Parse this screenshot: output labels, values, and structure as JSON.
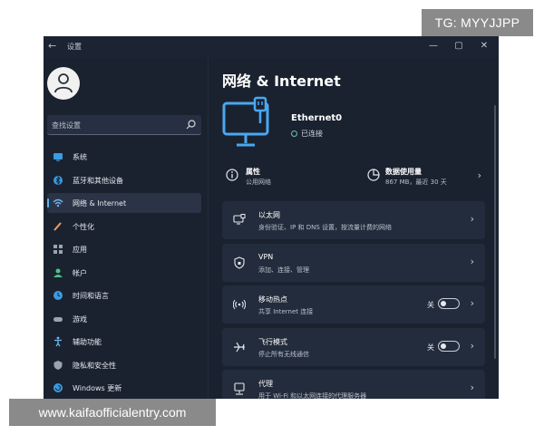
{
  "watermarks": {
    "top_right": "TG: MYYJJPP",
    "bottom_left": "www.kaifaofficialentry.com"
  },
  "window": {
    "title": "设置",
    "controls": {
      "minimize": "—",
      "maximize": "▢",
      "close": "✕"
    }
  },
  "sidebar": {
    "search_placeholder": "查找设置",
    "items": [
      {
        "label": "系统",
        "icon": "monitor-icon",
        "color": "#3b9be0"
      },
      {
        "label": "蓝牙和其他设备",
        "icon": "bluetooth-icon",
        "color": "#3b9be0"
      },
      {
        "label": "网络 & Internet",
        "icon": "wifi-icon",
        "color": "#6ab7f0",
        "active": true
      },
      {
        "label": "个性化",
        "icon": "brush-icon",
        "color": "#e8a06a"
      },
      {
        "label": "应用",
        "icon": "apps-icon",
        "color": "#9aa3b0"
      },
      {
        "label": "帐户",
        "icon": "person-icon",
        "color": "#4fc38a"
      },
      {
        "label": "时间和语言",
        "icon": "clock-icon",
        "color": "#3b9be0"
      },
      {
        "label": "游戏",
        "icon": "gamepad-icon",
        "color": "#9aa3b0"
      },
      {
        "label": "辅助功能",
        "icon": "accessibility-icon",
        "color": "#6ab7f0"
      },
      {
        "label": "隐私和安全性",
        "icon": "shield-icon",
        "color": "#9aa3b0"
      },
      {
        "label": "Windows 更新",
        "icon": "update-icon",
        "color": "#3b9be0"
      }
    ]
  },
  "main": {
    "title": "网络 & Internet",
    "connection": {
      "name": "Ethernet0",
      "status": "已连接"
    },
    "properties": {
      "title": "属性",
      "subtitle": "公用网络"
    },
    "data_usage": {
      "title": "数据使用量",
      "subtitle": "867 MB，最近 30 天"
    },
    "cards": [
      {
        "title": "以太网",
        "subtitle": "身份验证、IP 和 DNS 设置，按流量计费的网络",
        "icon": "ethernet-icon"
      },
      {
        "title": "VPN",
        "subtitle": "添加、连接、管理",
        "icon": "vpn-shield-icon"
      },
      {
        "title": "移动热点",
        "subtitle": "共享 Internet 连接",
        "icon": "hotspot-icon",
        "toggle_state": "关"
      },
      {
        "title": "飞行模式",
        "subtitle": "停止所有无线通信",
        "icon": "airplane-icon",
        "toggle_state": "关"
      },
      {
        "title": "代理",
        "subtitle": "用于 Wi-Fi 和以太网连接的代理服务器",
        "icon": "proxy-icon"
      }
    ]
  },
  "colors": {
    "accent": "#5fb8f5",
    "window_bg": "#1a2230",
    "card_bg": "#232c3c",
    "connected": "#6bc4a5"
  }
}
